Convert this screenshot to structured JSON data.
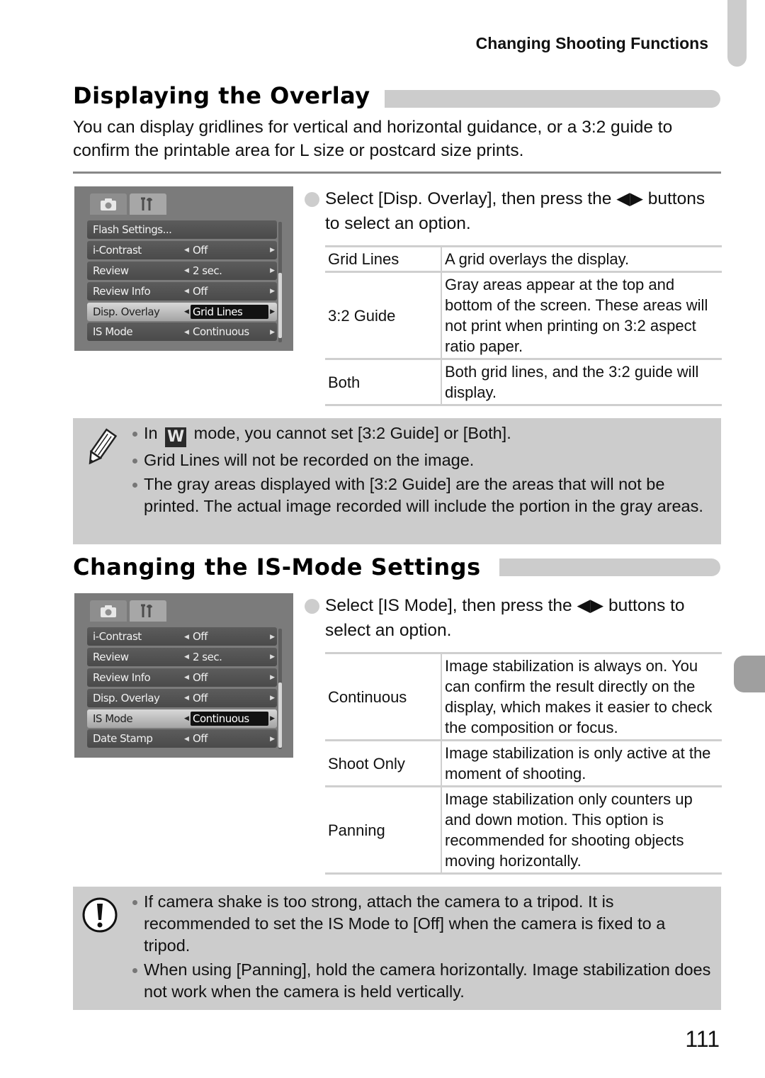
{
  "header": {
    "running_head": "Changing Shooting Functions"
  },
  "section1": {
    "title": "Displaying the Overlay",
    "intro": "You can display gridlines for vertical and horizontal guidance, or a 3:2 guide to confirm the printable area for L size or postcard size prints.",
    "lcd": {
      "tabs": [
        "camera-tab",
        "settings-tab"
      ],
      "rows": [
        {
          "label": "Flash Settings...",
          "value": ""
        },
        {
          "label": "i-Contrast",
          "value": "Off"
        },
        {
          "label": "Review",
          "value": "2 sec."
        },
        {
          "label": "Review Info",
          "value": "Off"
        },
        {
          "label": "Disp. Overlay",
          "value": "Grid Lines",
          "selected": true
        },
        {
          "label": "IS Mode",
          "value": "Continuous"
        }
      ]
    },
    "step_pre": "Select [Disp. Overlay], then press the ",
    "step_arrows": "◀▶",
    "step_post": " buttons to select an option.",
    "options": [
      {
        "name": "Grid Lines",
        "desc": "A grid overlays the display."
      },
      {
        "name": "3:2 Guide",
        "desc": "Gray areas appear at the top and bottom of the screen. These areas will not print when printing on 3:2 aspect ratio paper."
      },
      {
        "name": "Both",
        "desc": "Both grid lines, and the 3:2 guide will display."
      }
    ],
    "note": {
      "icon": "pencil-icon",
      "items": [
        {
          "pre": "In ",
          "mode_glyph": "W",
          "post": " mode, you cannot set [3:2 Guide] or [Both]."
        },
        {
          "text": "Grid Lines will not be recorded on the image."
        },
        {
          "text": "The gray areas displayed with [3:2 Guide] are the areas that will not be printed. The actual image recorded will include the portion in the gray areas."
        }
      ]
    }
  },
  "section2": {
    "title": "Changing the IS-Mode Settings",
    "lcd": {
      "tabs": [
        "camera-tab",
        "settings-tab"
      ],
      "rows": [
        {
          "label": "i-Contrast",
          "value": "Off"
        },
        {
          "label": "Review",
          "value": "2 sec."
        },
        {
          "label": "Review Info",
          "value": "Off"
        },
        {
          "label": "Disp. Overlay",
          "value": "Off"
        },
        {
          "label": "IS Mode",
          "value": "Continuous",
          "selected": true
        },
        {
          "label": "Date Stamp",
          "value": "Off"
        }
      ]
    },
    "step_pre": "Select [IS Mode], then press the ",
    "step_arrows": "◀▶",
    "step_post": " buttons to select an option.",
    "options": [
      {
        "name": "Continuous",
        "desc": "Image stabilization is always on. You can confirm the result directly on the display, which makes it easier to check the composition or focus."
      },
      {
        "name": "Shoot Only",
        "desc": "Image stabilization is only active at the moment of shooting."
      },
      {
        "name": "Panning",
        "desc": "Image stabilization only counters up and down motion. This option is recommended for shooting objects moving horizontally."
      }
    ],
    "caution": {
      "icon": "caution-icon",
      "items": [
        {
          "text": "If camera shake is too strong, attach the camera to a tripod. It is recommended to set the IS Mode to [Off] when the camera is fixed to a tripod."
        },
        {
          "text": "When using [Panning], hold the camera horizontally. Image stabilization does not work when the camera is held vertically."
        }
      ]
    }
  },
  "footer": {
    "page_number": "111"
  }
}
